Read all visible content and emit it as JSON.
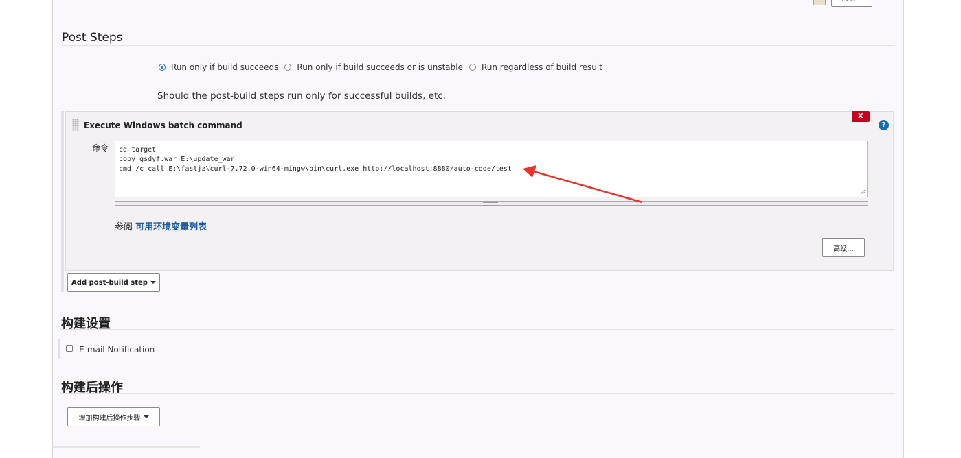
{
  "top": {
    "advanced_label": "高级..."
  },
  "post_steps": {
    "title": "Post Steps",
    "options": [
      {
        "label": "Run only if build succeeds",
        "checked": true
      },
      {
        "label": "Run only if build succeeds or is unstable",
        "checked": false
      },
      {
        "label": "Run regardless of build result",
        "checked": false
      }
    ],
    "help_text": "Should the post-build steps run only for successful builds, etc."
  },
  "step": {
    "title": "Execute Windows batch command",
    "delete_label": "X",
    "help_label": "?",
    "command_label": "命令",
    "command_value": "cd target\ncopy gsdyf.war E:\\update_war\ncmd /c call E:\\fastjz\\curl-7.72.0-win64-mingw\\bin\\curl.exe http://localhost:8880/auto-code/test",
    "see_also_prefix": "参阅",
    "see_also_link": "可用环境变量列表",
    "advanced_label": "高级..."
  },
  "add_post_build_step_label": "Add post-build step",
  "build_settings": {
    "title": "构建设置",
    "email_label": "E-mail Notification",
    "email_checked": false
  },
  "post_build": {
    "title": "构建后操作",
    "add_label": "增加构建后操作步骤"
  },
  "colors": {
    "accent": "#1e6fd0",
    "link": "#1f5c99",
    "danger": "#c7001f",
    "arrow": "#e8322a",
    "panel": "#f3f1f4"
  }
}
